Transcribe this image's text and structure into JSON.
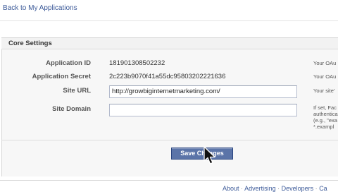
{
  "nav": {
    "back_link": "Back to My Applications"
  },
  "section": {
    "title": "Core Settings"
  },
  "fields": {
    "app_id": {
      "label": "Application ID",
      "value": "181901308502232",
      "help": "Your OAu"
    },
    "app_secret": {
      "label": "Application Secret",
      "value": "2c223b9070f41a55dc95803202221636",
      "help": "Your OAu"
    },
    "site_url": {
      "label": "Site URL",
      "value": "http://growbiginternetmarketing.com/",
      "help": "Your site'"
    },
    "site_domain": {
      "label": "Site Domain",
      "value": "",
      "help_lines": [
        "If set, Fac",
        "authentica",
        "(e.g., \"exa",
        "*.exampl"
      ]
    }
  },
  "actions": {
    "save_label": "Save Changes"
  },
  "footer": {
    "links": [
      "About",
      "Advertising",
      "Developers",
      "Ca"
    ],
    "separator": "·"
  },
  "colors": {
    "link": "#3b5998",
    "button": "#5b74a8",
    "panel": "#f7f7f7"
  }
}
